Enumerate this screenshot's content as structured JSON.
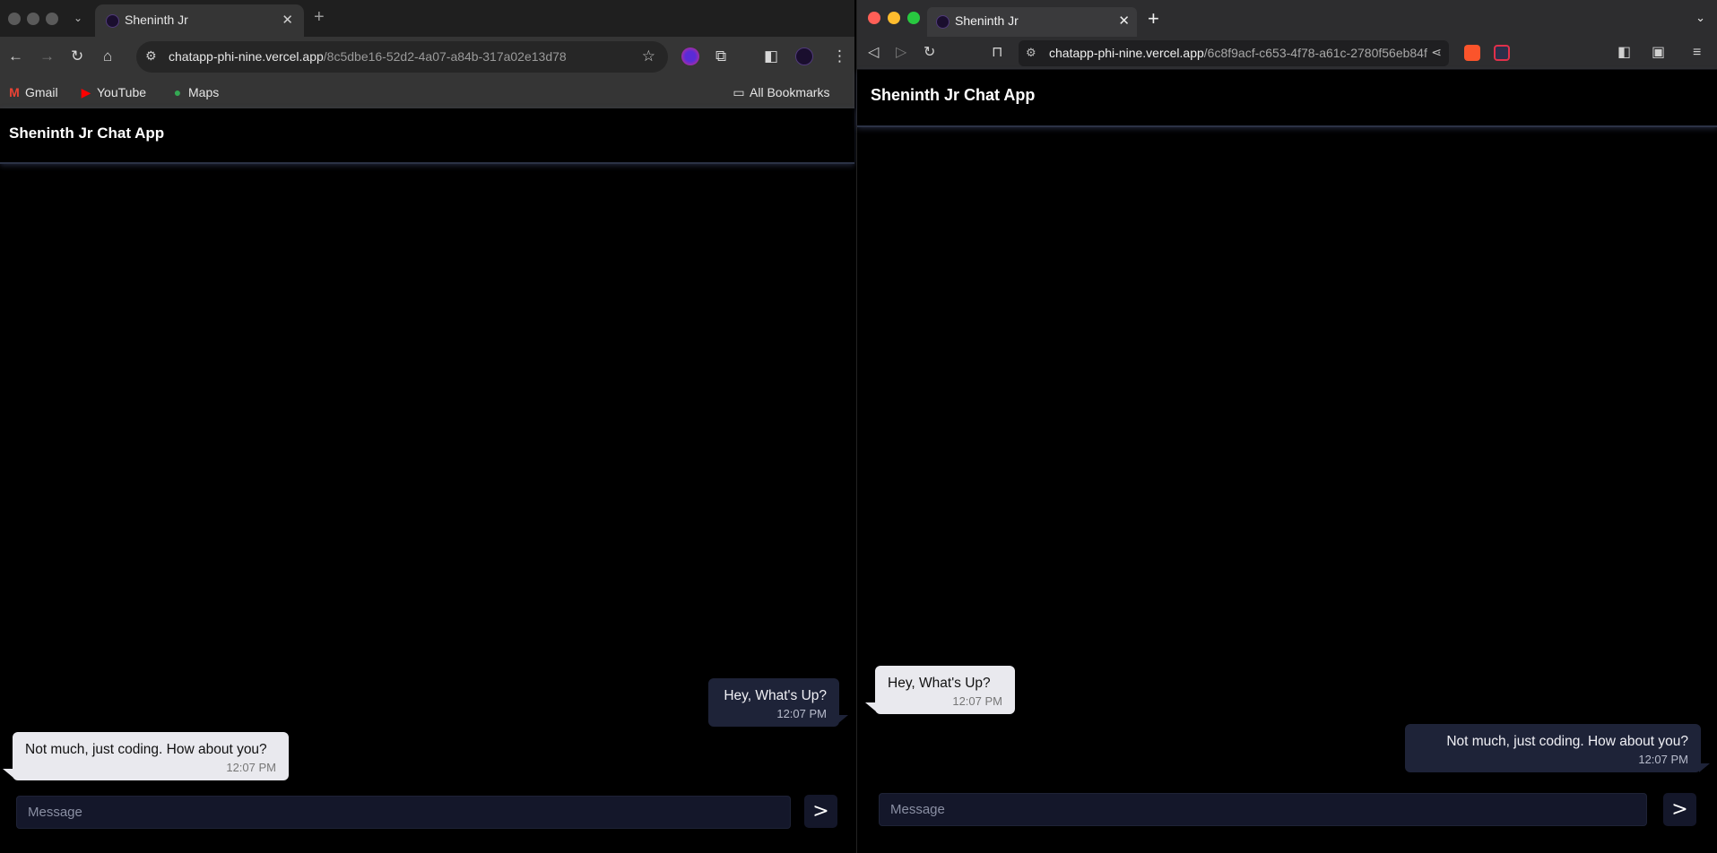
{
  "left_browser": {
    "tab_title": "Sheninth Jr",
    "url_host": "chatapp-phi-nine.vercel.app",
    "url_path": "/8c5dbe16-52d2-4a07-a84b-317a02e13d78",
    "bookmarks": [
      {
        "label": "Gmail",
        "icon": "gmail-icon"
      },
      {
        "label": "YouTube",
        "icon": "youtube-icon"
      },
      {
        "label": "Maps",
        "icon": "maps-icon"
      }
    ],
    "bookmarks_folder": "All Bookmarks",
    "app": {
      "title": "Sheninth Jr Chat App",
      "messages": [
        {
          "text": "Hey, What's Up?",
          "time": "12:07 PM",
          "side": "right"
        },
        {
          "text": "Not much, just coding. How about you?",
          "time": "12:07 PM",
          "side": "left"
        }
      ],
      "input_placeholder": "Message",
      "send_label": ">"
    }
  },
  "right_browser": {
    "tab_title": "Sheninth Jr",
    "url_host": "chatapp-phi-nine.vercel.app",
    "url_path": "/6c8f9acf-c653-4f78-a61c-2780f56eb84f",
    "app": {
      "title": "Sheninth Jr Chat App",
      "messages": [
        {
          "text": "Hey, What's Up?",
          "time": "12:07 PM",
          "side": "left"
        },
        {
          "text": "Not much, just coding. How about you?",
          "time": "12:07 PM",
          "side": "right"
        }
      ],
      "input_placeholder": "Message",
      "send_label": ">"
    }
  },
  "colors": {
    "app_background": "#000000",
    "bubble_light": "#e9e9ee",
    "bubble_dark": "#1e2338",
    "input_background": "#14172a"
  }
}
